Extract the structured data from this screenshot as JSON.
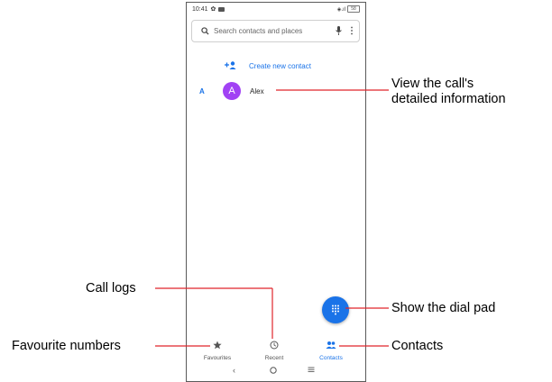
{
  "status_bar": {
    "time": "10:41",
    "battery": "58"
  },
  "search": {
    "placeholder": "Search contacts and places"
  },
  "create_contact": {
    "label": "Create new contact"
  },
  "contacts": [
    {
      "section": "A",
      "initial": "A",
      "name": "Alex"
    }
  ],
  "bottom_nav": {
    "favourites": "Favourites",
    "recent": "Recent",
    "contacts": "Contacts"
  },
  "annotations": {
    "detail_line1": "View the call's",
    "detail_line2": "detailed information",
    "call_logs": "Call logs",
    "dial_pad": "Show the dial pad",
    "favourites": "Favourite numbers",
    "contacts": "Contacts"
  },
  "colors": {
    "accent": "#1a73e8",
    "avatar": "#a142f4",
    "callout_line": "#e0242b"
  }
}
